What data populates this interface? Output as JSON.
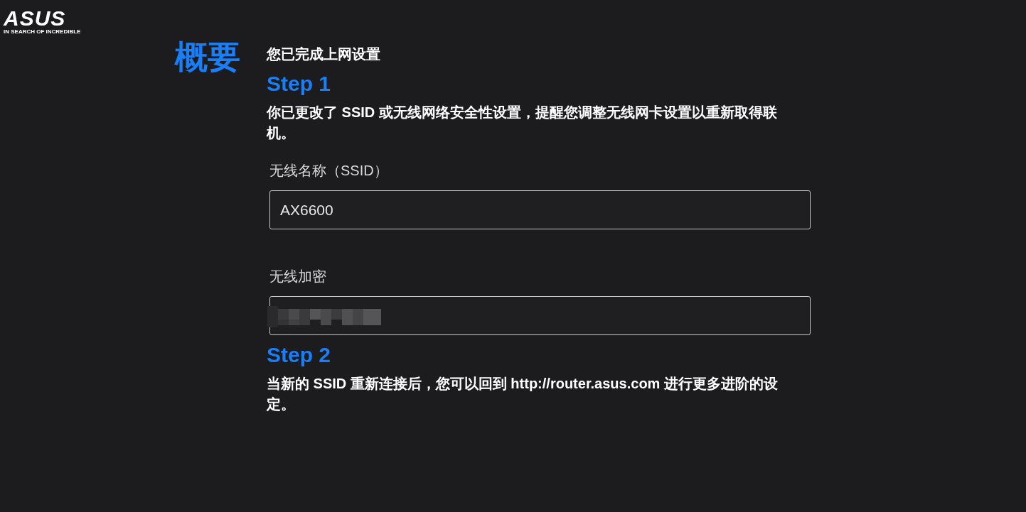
{
  "logo": {
    "wordmark": "ASUS",
    "tagline": "IN SEARCH OF INCREDIBLE"
  },
  "title": "概要",
  "subtitle": "您已完成上网设置",
  "steps": [
    {
      "heading": "Step 1",
      "text": "你已更改了 SSID 或无线网络安全性设置，提醒您调整无线网卡设置以重新取得联机。"
    },
    {
      "heading": "Step 2",
      "text": "当新的 SSID 重新连接后，您可以回到 http://router.asus.com 进行更多进阶的设定。"
    }
  ],
  "fields": [
    {
      "kind": "text",
      "label": "无线名称（SSID）",
      "value": "AX6600"
    },
    {
      "kind": "redacted",
      "label": "无线加密"
    }
  ]
}
